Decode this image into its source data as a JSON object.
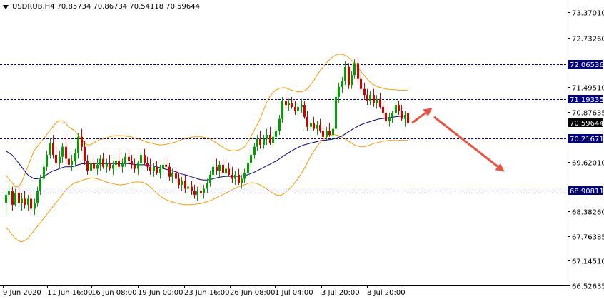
{
  "header": {
    "symbol_timeframe": "USDRUB,H4",
    "ohlc": "70.85734 70.86734 70.54118 70.59644"
  },
  "colors": {
    "bull": "#00a000",
    "bear": "#d00000",
    "bb": "#ff9900",
    "ma": "#000080",
    "hline": "#000080",
    "label_bg": "#000080",
    "current_bg": "#000000",
    "arrow": "#ee5040"
  },
  "price_axis": {
    "ticks": [
      "73.37010",
      "72.73260",
      "71.49510",
      "70.87635",
      "69.62010",
      "68.38260",
      "67.76385",
      "67.14510",
      "66.52635"
    ],
    "range": [
      66.52635,
      73.68
    ]
  },
  "time_axis": {
    "labels": [
      "9 Jun 2020",
      "11 Jun 16:00",
      "16 Jun 08:00",
      "19 Jun 00:00",
      "23 Jun 16:00",
      "26 Jun 08:00",
      "1 Jul 04:00",
      "3 Jul 20:00",
      "8 Jul 20:00"
    ]
  },
  "levels": [
    {
      "label": "72.06536",
      "value": 72.06536
    },
    {
      "label": "71.19335",
      "value": 71.19335
    },
    {
      "label": "70.21671",
      "value": 70.21671
    },
    {
      "label": "68.90811",
      "value": 68.90811
    }
  ],
  "current": {
    "label": "70.59644",
    "value": 70.59644
  },
  "forecast_arrows": [
    {
      "from": [
        0,
        70.6
      ],
      "to": [
        6,
        70.95
      ]
    },
    {
      "from": [
        7,
        70.75
      ],
      "to": [
        29,
        69.4
      ]
    }
  ],
  "chart_data": {
    "type": "candlestick",
    "title": "USDRUB,H4",
    "ylim": [
      66.52635,
      73.68
    ],
    "x_labels": [
      "9 Jun 2020",
      "11 Jun 16:00",
      "16 Jun 08:00",
      "19 Jun 00:00",
      "23 Jun 16:00",
      "26 Jun 08:00",
      "1 Jul 04:00",
      "3 Jul 20:00",
      "8 Jul 20:00"
    ],
    "candles": [
      [
        68.6,
        68.9,
        68.3,
        68.8
      ],
      [
        68.8,
        69.1,
        68.6,
        68.9
      ],
      [
        68.9,
        69.0,
        68.4,
        68.55
      ],
      [
        68.55,
        68.95,
        68.5,
        68.85
      ],
      [
        68.85,
        69.0,
        68.5,
        68.6
      ],
      [
        68.6,
        68.85,
        68.4,
        68.7
      ],
      [
        68.7,
        68.9,
        68.45,
        68.55
      ],
      [
        68.55,
        68.8,
        68.4,
        68.7
      ],
      [
        68.7,
        68.85,
        68.3,
        68.45
      ],
      [
        68.45,
        68.7,
        68.3,
        68.6
      ],
      [
        68.6,
        69.0,
        68.5,
        68.9
      ],
      [
        68.9,
        69.3,
        68.8,
        69.2
      ],
      [
        69.2,
        69.6,
        69.1,
        69.5
      ],
      [
        69.5,
        69.9,
        69.4,
        69.8
      ],
      [
        69.8,
        70.2,
        69.7,
        70.1
      ],
      [
        70.1,
        70.3,
        69.7,
        69.8
      ],
      [
        69.8,
        70.0,
        69.5,
        69.6
      ],
      [
        69.6,
        69.9,
        69.45,
        69.75
      ],
      [
        69.75,
        70.1,
        69.6,
        70.0
      ],
      [
        70.0,
        70.3,
        69.6,
        69.7
      ],
      [
        69.7,
        69.9,
        69.45,
        69.55
      ],
      [
        69.55,
        69.8,
        69.4,
        69.65
      ],
      [
        69.65,
        69.95,
        69.5,
        69.85
      ],
      [
        69.85,
        70.35,
        69.7,
        70.25
      ],
      [
        70.25,
        70.45,
        69.9,
        70.0
      ],
      [
        70.0,
        70.15,
        69.55,
        69.65
      ],
      [
        69.65,
        69.8,
        69.3,
        69.4
      ],
      [
        69.4,
        69.7,
        69.3,
        69.6
      ],
      [
        69.6,
        69.75,
        69.35,
        69.45
      ],
      [
        69.45,
        69.7,
        69.3,
        69.55
      ],
      [
        69.55,
        69.8,
        69.4,
        69.7
      ],
      [
        69.7,
        69.85,
        69.45,
        69.5
      ],
      [
        69.5,
        69.7,
        69.35,
        69.6
      ],
      [
        69.6,
        69.8,
        69.4,
        69.45
      ],
      [
        69.45,
        69.65,
        69.3,
        69.55
      ],
      [
        69.55,
        69.75,
        69.4,
        69.65
      ],
      [
        69.65,
        69.85,
        69.45,
        69.5
      ],
      [
        69.5,
        69.7,
        69.35,
        69.6
      ],
      [
        69.6,
        69.85,
        69.5,
        69.75
      ],
      [
        69.75,
        69.95,
        69.55,
        69.65
      ],
      [
        69.65,
        69.8,
        69.45,
        69.55
      ],
      [
        69.55,
        69.7,
        69.35,
        69.45
      ],
      [
        69.45,
        69.65,
        69.3,
        69.6
      ],
      [
        69.6,
        69.9,
        69.5,
        69.8
      ],
      [
        69.8,
        69.95,
        69.55,
        69.6
      ],
      [
        69.6,
        69.75,
        69.4,
        69.5
      ],
      [
        69.5,
        69.7,
        69.3,
        69.4
      ],
      [
        69.4,
        69.6,
        69.25,
        69.5
      ],
      [
        69.5,
        69.65,
        69.3,
        69.35
      ],
      [
        69.35,
        69.55,
        69.2,
        69.45
      ],
      [
        69.45,
        69.65,
        69.3,
        69.55
      ],
      [
        69.55,
        69.75,
        69.4,
        69.5
      ],
      [
        69.5,
        69.6,
        69.15,
        69.25
      ],
      [
        69.25,
        69.45,
        69.1,
        69.35
      ],
      [
        69.35,
        69.5,
        69.15,
        69.2
      ],
      [
        69.2,
        69.35,
        68.95,
        69.05
      ],
      [
        69.05,
        69.25,
        68.9,
        69.15
      ],
      [
        69.15,
        69.3,
        68.85,
        68.95
      ],
      [
        68.95,
        69.1,
        68.75,
        69.0
      ],
      [
        69.0,
        69.15,
        68.8,
        68.9
      ],
      [
        68.9,
        69.05,
        68.7,
        68.8
      ],
      [
        68.8,
        69.0,
        68.65,
        68.9
      ],
      [
        68.9,
        69.1,
        68.75,
        68.85
      ],
      [
        68.85,
        69.05,
        68.7,
        68.95
      ],
      [
        68.95,
        69.2,
        68.85,
        69.1
      ],
      [
        69.1,
        69.4,
        69.0,
        69.3
      ],
      [
        69.3,
        69.6,
        69.2,
        69.5
      ],
      [
        69.5,
        69.7,
        69.3,
        69.4
      ],
      [
        69.4,
        69.65,
        69.25,
        69.55
      ],
      [
        69.55,
        69.7,
        69.3,
        69.35
      ],
      [
        69.35,
        69.55,
        69.2,
        69.45
      ],
      [
        69.45,
        69.6,
        69.25,
        69.3
      ],
      [
        69.3,
        69.5,
        69.1,
        69.2
      ],
      [
        69.2,
        69.4,
        69.05,
        69.3
      ],
      [
        69.3,
        69.45,
        69.05,
        69.1
      ],
      [
        69.1,
        69.3,
        68.95,
        69.2
      ],
      [
        69.2,
        69.45,
        69.1,
        69.35
      ],
      [
        69.35,
        69.7,
        69.25,
        69.6
      ],
      [
        69.6,
        69.9,
        69.5,
        69.8
      ],
      [
        69.8,
        70.1,
        69.7,
        70.0
      ],
      [
        70.0,
        70.3,
        69.9,
        70.2
      ],
      [
        70.2,
        70.4,
        69.95,
        70.05
      ],
      [
        70.05,
        70.3,
        69.95,
        70.2
      ],
      [
        70.2,
        70.45,
        70.05,
        70.3
      ],
      [
        70.3,
        70.5,
        70.05,
        70.1
      ],
      [
        70.1,
        70.35,
        70.0,
        70.25
      ],
      [
        70.25,
        70.5,
        70.1,
        70.4
      ],
      [
        70.4,
        70.8,
        70.3,
        70.7
      ],
      [
        70.7,
        71.25,
        70.6,
        71.15
      ],
      [
        71.15,
        71.3,
        70.95,
        71.05
      ],
      [
        71.05,
        71.2,
        70.9,
        71.1
      ],
      [
        71.1,
        71.25,
        70.95,
        71.0
      ],
      [
        71.0,
        71.15,
        70.8,
        70.9
      ],
      [
        70.9,
        71.1,
        70.75,
        71.0
      ],
      [
        71.0,
        71.2,
        70.85,
        71.05
      ],
      [
        71.05,
        71.15,
        70.7,
        70.75
      ],
      [
        70.75,
        70.9,
        70.4,
        70.5
      ],
      [
        70.5,
        70.7,
        70.35,
        70.6
      ],
      [
        70.6,
        70.75,
        70.4,
        70.45
      ],
      [
        70.45,
        70.65,
        70.3,
        70.55
      ],
      [
        70.55,
        70.7,
        70.35,
        70.4
      ],
      [
        70.4,
        70.55,
        70.15,
        70.25
      ],
      [
        70.25,
        70.5,
        70.15,
        70.4
      ],
      [
        70.4,
        70.6,
        70.25,
        70.3
      ],
      [
        70.3,
        70.5,
        70.15,
        70.45
      ],
      [
        70.45,
        71.35,
        70.4,
        71.25
      ],
      [
        71.25,
        71.6,
        71.1,
        71.5
      ],
      [
        71.5,
        71.75,
        71.35,
        71.65
      ],
      [
        71.65,
        72.15,
        71.55,
        72.0
      ],
      [
        72.0,
        72.1,
        71.45,
        71.55
      ],
      [
        71.55,
        71.9,
        71.45,
        71.8
      ],
      [
        71.8,
        72.2,
        71.7,
        72.1
      ],
      [
        72.1,
        72.25,
        71.6,
        71.7
      ],
      [
        71.7,
        71.85,
        71.35,
        71.45
      ],
      [
        71.45,
        71.6,
        71.2,
        71.3
      ],
      [
        71.3,
        71.45,
        71.05,
        71.15
      ],
      [
        71.15,
        71.4,
        71.05,
        71.3
      ],
      [
        71.3,
        71.45,
        71.0,
        71.1
      ],
      [
        71.1,
        71.3,
        70.95,
        71.2
      ],
      [
        71.2,
        71.35,
        70.95,
        71.0
      ],
      [
        71.0,
        71.15,
        70.75,
        70.85
      ],
      [
        70.85,
        71.0,
        70.55,
        70.65
      ],
      [
        70.65,
        70.85,
        70.5,
        70.75
      ],
      [
        70.75,
        70.9,
        70.6,
        70.85
      ],
      [
        70.85,
        71.2,
        70.75,
        71.05
      ],
      [
        71.05,
        71.15,
        70.8,
        70.9
      ],
      [
        70.9,
        71.05,
        70.65,
        70.7
      ],
      [
        70.7,
        70.9,
        70.5,
        70.8
      ],
      [
        70.85,
        70.87,
        70.54,
        70.6
      ]
    ],
    "ma": [
      69.9,
      69.85,
      69.8,
      69.7,
      69.6,
      69.5,
      69.4,
      69.3,
      69.25,
      69.2,
      69.2,
      69.22,
      69.25,
      69.3,
      69.35,
      69.4,
      69.42,
      69.45,
      69.48,
      69.5,
      69.5,
      69.5,
      69.52,
      69.55,
      69.57,
      69.58,
      69.58,
      69.58,
      69.58,
      69.58,
      69.58,
      69.58,
      69.58,
      69.58,
      69.58,
      69.58,
      69.58,
      69.58,
      69.58,
      69.58,
      69.57,
      69.56,
      69.55,
      69.55,
      69.55,
      69.54,
      69.53,
      69.52,
      69.5,
      69.48,
      69.46,
      69.44,
      69.42,
      69.4,
      69.38,
      69.35,
      69.32,
      69.3,
      69.28,
      69.25,
      69.23,
      69.2,
      69.18,
      69.17,
      69.17,
      69.18,
      69.2,
      69.22,
      69.24,
      69.25,
      69.26,
      69.26,
      69.26,
      69.26,
      69.26,
      69.27,
      69.28,
      69.3,
      69.33,
      69.36,
      69.4,
      69.44,
      69.48,
      69.52,
      69.56,
      69.6,
      69.64,
      69.69,
      69.75,
      69.8,
      69.85,
      69.9,
      69.94,
      69.98,
      70.02,
      70.05,
      70.07,
      70.09,
      70.11,
      70.13,
      70.15,
      70.16,
      70.17,
      70.18,
      70.19,
      70.21,
      70.24,
      70.27,
      70.32,
      70.37,
      70.42,
      70.47,
      70.51,
      70.55,
      70.58,
      70.61,
      70.63,
      70.66,
      70.68,
      70.7,
      70.71,
      70.72,
      70.73,
      70.74,
      70.75,
      70.76,
      70.77,
      70.77,
      70.78
    ],
    "bb_upper": [
      69.3,
      69.2,
      69.1,
      69.0,
      69.0,
      69.1,
      69.3,
      69.5,
      69.7,
      69.9,
      70.0,
      70.1,
      70.2,
      70.3,
      70.4,
      70.5,
      70.6,
      70.65,
      70.65,
      70.6,
      70.5,
      70.45,
      70.4,
      70.3,
      70.2,
      70.1,
      70.05,
      70.05,
      70.1,
      70.15,
      70.18,
      70.2,
      70.22,
      70.25,
      70.27,
      70.28,
      70.28,
      70.28,
      70.27,
      70.26,
      70.25,
      70.22,
      70.2,
      70.18,
      70.15,
      70.12,
      70.1,
      70.08,
      70.06,
      70.05,
      70.05,
      70.06,
      70.08,
      70.1,
      70.12,
      70.15,
      70.18,
      70.2,
      70.22,
      70.24,
      70.25,
      70.25,
      70.25,
      70.24,
      70.22,
      70.2,
      70.15,
      70.1,
      70.05,
      70.0,
      69.95,
      69.92,
      69.9,
      69.9,
      69.92,
      69.95,
      70.0,
      70.1,
      70.25,
      70.4,
      70.55,
      70.7,
      70.9,
      71.1,
      71.25,
      71.35,
      71.42,
      71.46,
      71.48,
      71.48,
      71.45,
      71.42,
      71.4,
      71.38,
      71.38,
      71.4,
      71.45,
      71.55,
      71.65,
      71.78,
      71.9,
      72.0,
      72.1,
      72.18,
      72.25,
      72.3,
      72.32,
      72.32,
      72.3,
      72.25,
      72.18,
      72.1,
      72.0,
      71.9,
      71.8,
      71.7,
      71.62,
      71.56,
      71.52,
      71.49,
      71.47,
      71.45,
      71.44,
      71.43,
      71.43,
      71.42,
      71.42,
      71.42,
      71.42
    ],
    "bb_lower": [
      68.0,
      67.9,
      67.8,
      67.7,
      67.65,
      67.62,
      67.65,
      67.7,
      67.8,
      67.9,
      68.0,
      68.1,
      68.2,
      68.3,
      68.4,
      68.5,
      68.6,
      68.7,
      68.8,
      68.9,
      68.98,
      69.05,
      69.1,
      69.12,
      69.15,
      69.18,
      69.2,
      69.22,
      69.22,
      69.2,
      69.18,
      69.15,
      69.12,
      69.1,
      69.08,
      69.06,
      69.05,
      69.05,
      69.06,
      69.08,
      69.1,
      69.12,
      69.12,
      69.12,
      69.1,
      69.06,
      69.0,
      68.92,
      68.85,
      68.78,
      68.72,
      68.68,
      68.65,
      68.62,
      68.6,
      68.58,
      68.56,
      68.55,
      68.55,
      68.55,
      68.56,
      68.57,
      68.58,
      68.6,
      68.62,
      68.65,
      68.68,
      68.72,
      68.76,
      68.8,
      68.84,
      68.88,
      68.92,
      68.96,
      69.0,
      69.02,
      69.05,
      69.08,
      69.1,
      69.1,
      69.08,
      69.05,
      69.0,
      68.95,
      68.9,
      68.85,
      68.8,
      68.78,
      68.8,
      68.85,
      68.92,
      69.0,
      69.1,
      69.2,
      69.32,
      69.45,
      69.6,
      69.75,
      69.88,
      70.0,
      70.1,
      70.18,
      70.24,
      70.28,
      70.3,
      70.3,
      70.28,
      70.25,
      70.2,
      70.15,
      70.1,
      70.05,
      70.02,
      70.0,
      70.0,
      70.02,
      70.05,
      70.08,
      70.1,
      70.12,
      70.14,
      70.15,
      70.16,
      70.16,
      70.16,
      70.16,
      70.16,
      70.16,
      70.16
    ]
  }
}
